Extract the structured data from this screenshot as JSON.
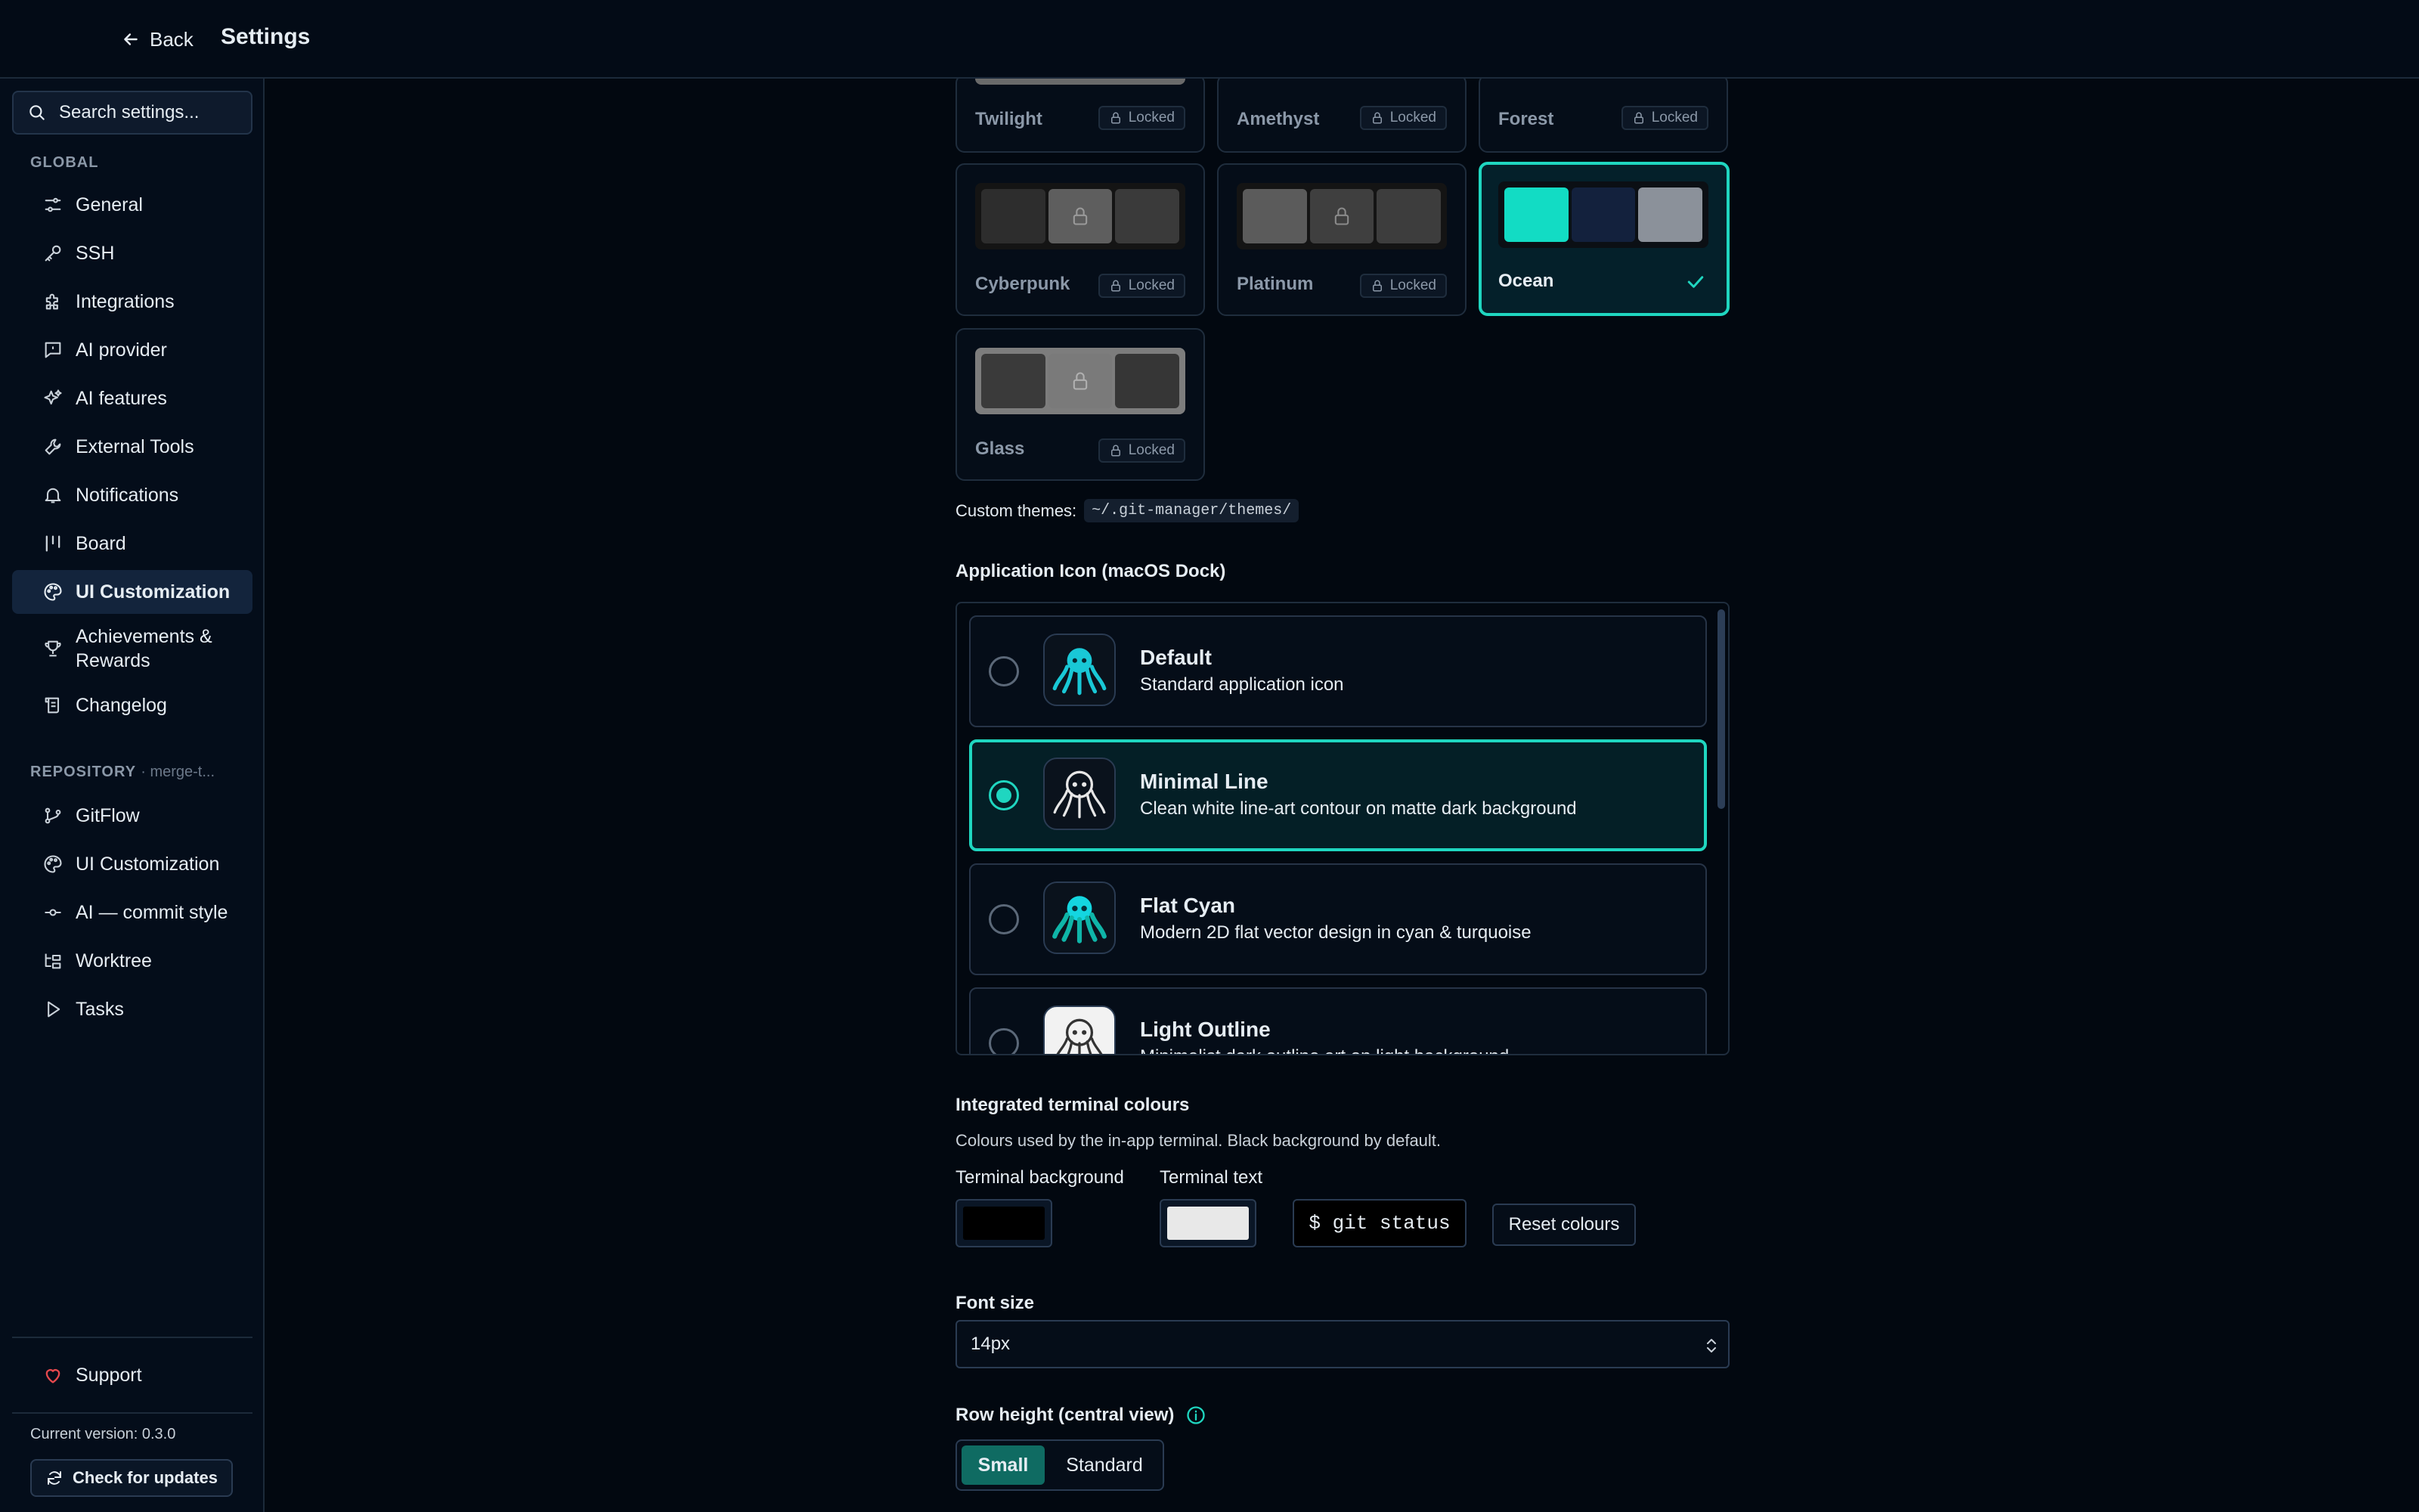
{
  "header": {
    "back_label": "Back",
    "title": "Settings"
  },
  "sidebar": {
    "search_placeholder": "Search settings...",
    "global_label": "GLOBAL",
    "global_items": [
      {
        "label": "General",
        "icon": "sliders-icon"
      },
      {
        "label": "SSH",
        "icon": "key-icon"
      },
      {
        "label": "Integrations",
        "icon": "puzzle-icon"
      },
      {
        "label": "AI provider",
        "icon": "chat-icon"
      },
      {
        "label": "AI features",
        "icon": "sparkles-icon"
      },
      {
        "label": "External Tools",
        "icon": "wrench-icon"
      },
      {
        "label": "Notifications",
        "icon": "bell-icon"
      },
      {
        "label": "Board",
        "icon": "board-icon"
      },
      {
        "label": "UI Customization",
        "icon": "palette-icon",
        "active": true
      },
      {
        "label": "Achievements & Rewards",
        "icon": "trophy-icon"
      },
      {
        "label": "Changelog",
        "icon": "scroll-icon"
      }
    ],
    "repository_label": "REPOSITORY",
    "repository_name": "· merge-t...",
    "repo_items": [
      {
        "label": "GitFlow",
        "icon": "git-branch-icon"
      },
      {
        "label": "UI Customization",
        "icon": "palette-icon"
      },
      {
        "label": "AI — commit style",
        "icon": "git-commit-icon"
      },
      {
        "label": "Worktree",
        "icon": "folder-tree-icon"
      },
      {
        "label": "Tasks",
        "icon": "play-icon"
      }
    ],
    "support_label": "Support",
    "version_text": "Current version: 0.3.0",
    "update_button": "Check for updates"
  },
  "themes": {
    "locked_label": "Locked",
    "cards": [
      {
        "name": "Twilight",
        "locked": true,
        "swatches": [
          "#5a5a5a",
          "#6b6b6b",
          "#5a5a5a"
        ]
      },
      {
        "name": "Amethyst",
        "locked": true,
        "swatches": [
          "#111",
          "#111",
          "#111"
        ]
      },
      {
        "name": "Forest",
        "locked": true,
        "swatches": [
          "#111",
          "#111",
          "#111"
        ]
      },
      {
        "name": "Cyberpunk",
        "locked": true,
        "swatches": [
          "#2d2d2d",
          "#5e5e5e",
          "#3a3a3a"
        ]
      },
      {
        "name": "Platinum",
        "locked": true,
        "swatches": [
          "#5b5b5b",
          "#3f3f3f",
          "#3d3d3d"
        ]
      },
      {
        "name": "Ocean",
        "locked": false,
        "selected": true,
        "swatches": [
          "#12dcc4",
          "#13213d",
          "#8b919a"
        ]
      },
      {
        "name": "Glass",
        "locked": true,
        "swatches": [
          "#3a3a3a",
          "#7a7a7a",
          "#363636"
        ]
      }
    ],
    "custom_label": "Custom themes:",
    "custom_path": "~/.git-manager/themes/"
  },
  "app_icon": {
    "title": "Application Icon (macOS Dock)",
    "options": [
      {
        "title": "Default",
        "desc": "Standard application icon",
        "selected": false,
        "icon": "octopus-cyan-icon"
      },
      {
        "title": "Minimal Line",
        "desc": "Clean white line-art contour on matte dark background",
        "selected": true,
        "icon": "octopus-line-icon"
      },
      {
        "title": "Flat Cyan",
        "desc": "Modern 2D flat vector design in cyan & turquoise",
        "selected": false,
        "icon": "octopus-flat-icon"
      },
      {
        "title": "Light Outline",
        "desc": "Minimalist dark outline art on light background",
        "selected": false,
        "icon": "octopus-outline-icon"
      }
    ]
  },
  "terminal": {
    "title": "Integrated terminal colours",
    "desc": "Colours used by the in-app terminal. Black background by default.",
    "bg_label": "Terminal background",
    "text_label": "Terminal text",
    "bg_color": "#000000",
    "text_color": "#e8e8e8",
    "preview": "$ git status",
    "reset_label": "Reset colours"
  },
  "font_size": {
    "label": "Font size",
    "value": "14px"
  },
  "row_height": {
    "label": "Row height (central view)",
    "options": [
      "Small",
      "Standard"
    ],
    "selected": "Small"
  },
  "colors": {
    "accent": "#1fd6c0",
    "background": "#020810",
    "support_heart": "#e5484d"
  }
}
